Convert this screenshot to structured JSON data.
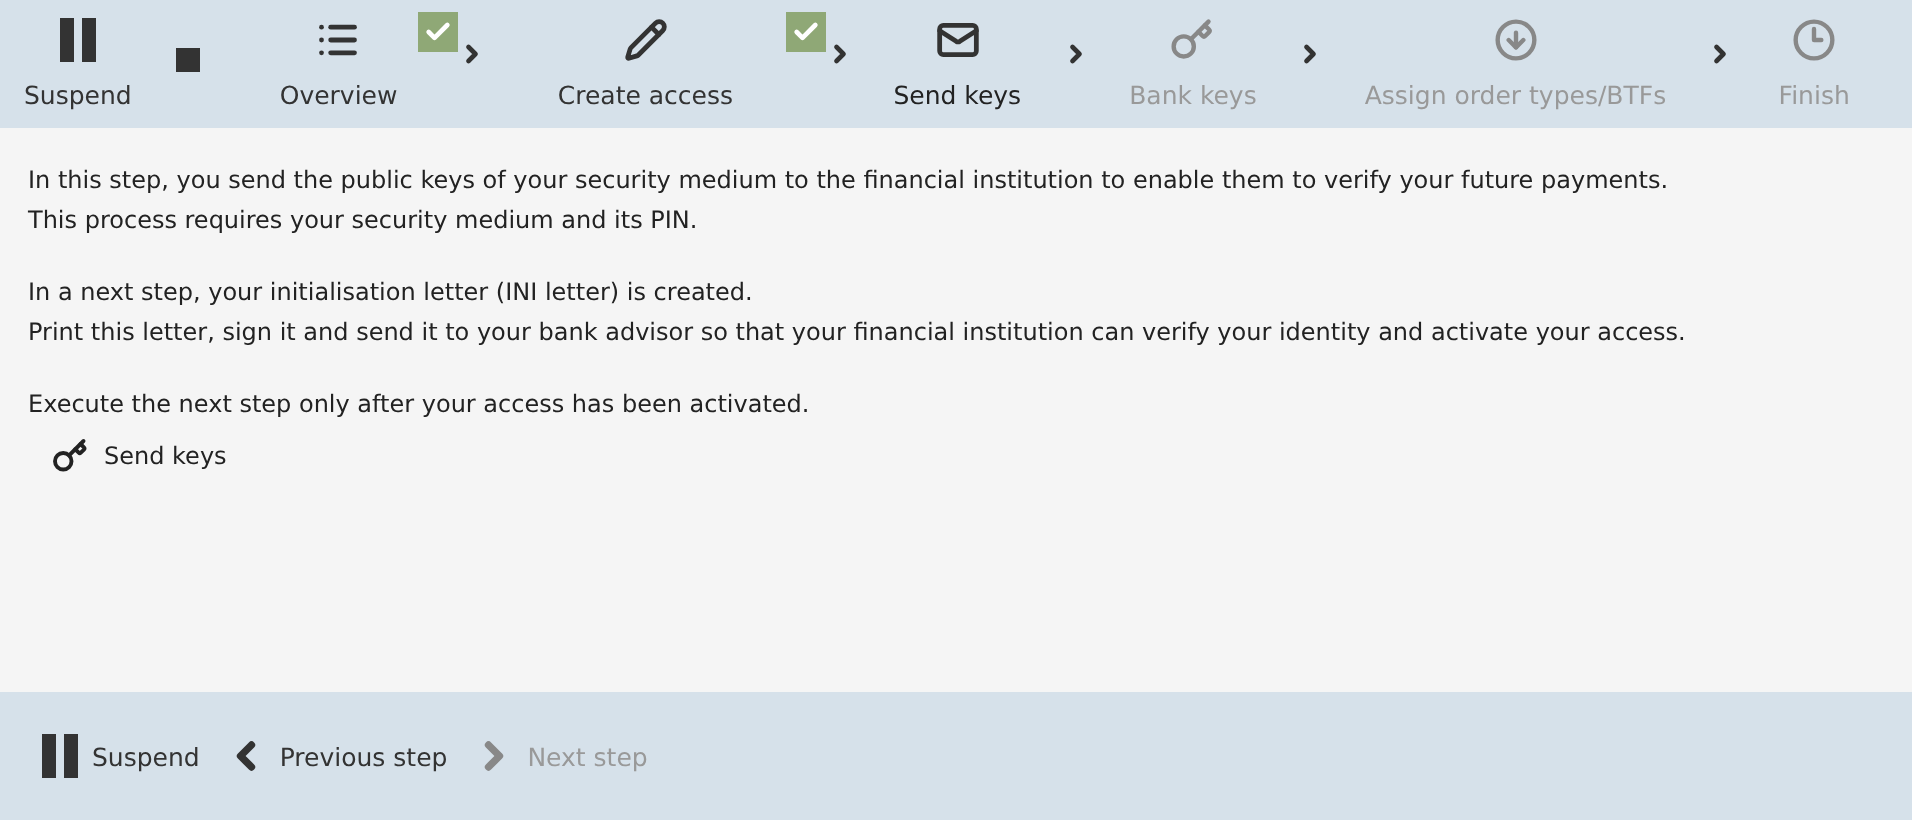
{
  "toolbar": {
    "suspend": {
      "label": "Suspend"
    },
    "steps": [
      {
        "label": "Overview",
        "completed": true,
        "current": false,
        "disabled": false
      },
      {
        "label": "Create access",
        "completed": true,
        "current": false,
        "disabled": false
      },
      {
        "label": "Send keys",
        "completed": false,
        "current": true,
        "disabled": false
      },
      {
        "label": "Bank keys",
        "completed": false,
        "current": false,
        "disabled": true
      },
      {
        "label": "Assign order types/BTFs",
        "completed": false,
        "current": false,
        "disabled": true
      },
      {
        "label": "Finish",
        "completed": false,
        "current": false,
        "disabled": true
      }
    ]
  },
  "content": {
    "paragraphs": [
      [
        "In this step, you send the public keys of your security medium to the financial institution to enable them to verify your future payments.",
        "This process requires your security medium and its PIN."
      ],
      [
        "In a next step, your initialisation letter (INI letter) is created.",
        "Print this letter, sign it and send it to your bank advisor so that your financial institution can verify your identity and activate your access."
      ],
      [
        "Execute the next step only after your access has been activated."
      ]
    ],
    "action": {
      "label": "Send keys"
    }
  },
  "footer": [
    {
      "label": "Suspend",
      "disabled": false
    },
    {
      "label": "Previous step",
      "disabled": false
    },
    {
      "label": "Next step",
      "disabled": true
    }
  ]
}
